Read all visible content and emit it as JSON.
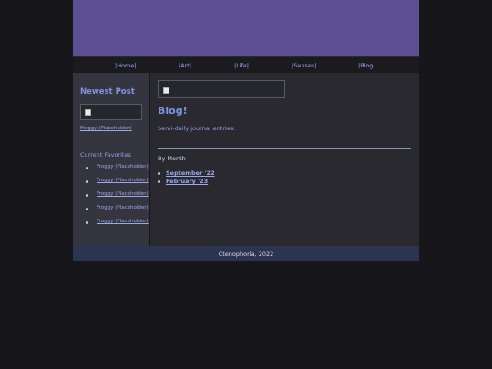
{
  "nav": {
    "items": [
      "|Home|",
      "|Art|",
      "|Life|",
      "|Senses|",
      "|Blog|"
    ]
  },
  "sidebar": {
    "newest_title": "Newest Post",
    "newest_link": "Froggy (Placeholder)",
    "favorites_title": "Current Favorites",
    "favorites": [
      "Froggy (Placeholder)",
      "Froggy (Placeholder)",
      "Froggy (Placeholder)",
      "Froggy (Placeholder)",
      "Froggy (Placeholder)"
    ]
  },
  "content": {
    "title": "Blog!",
    "subtitle": "Semi-daily journal entries.",
    "month_heading": "By Month",
    "months": [
      "September '22",
      "February '23"
    ]
  },
  "footer": {
    "text": "Ctenophoria, 2022"
  },
  "colors": {
    "background": "#17171b",
    "banner": "#5d4e92",
    "sidebar": "#35353f",
    "content": "#29292f",
    "footer": "#2b3550",
    "accent": "#7f93e0"
  }
}
